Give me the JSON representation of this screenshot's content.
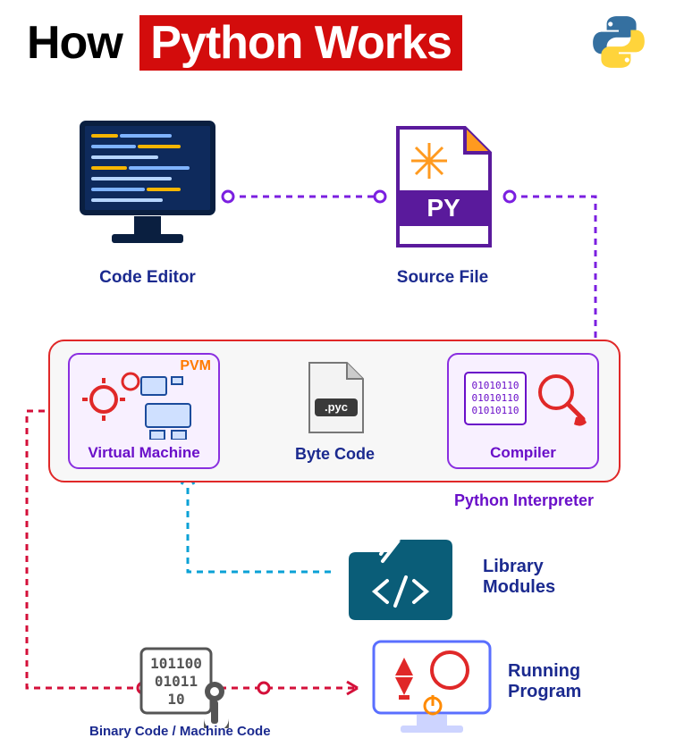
{
  "title": {
    "part1": "How",
    "part2": "Python Works"
  },
  "nodes": {
    "editor": "Code Editor",
    "source": "Source File",
    "source_ext": "PY",
    "vm": "Virtual Machine",
    "vm_tag": "PVM",
    "byte": "Byte Code",
    "byte_ext": ".pyc",
    "compiler": "Compiler",
    "compiler_bits": "01010110",
    "interpreter": "Python Interpreter",
    "library": "Library\nModules",
    "binary": "Binary Code / Machine Code",
    "binary_bits": [
      "101100",
      "01011",
      "10"
    ],
    "running": "Running\nProgram"
  }
}
